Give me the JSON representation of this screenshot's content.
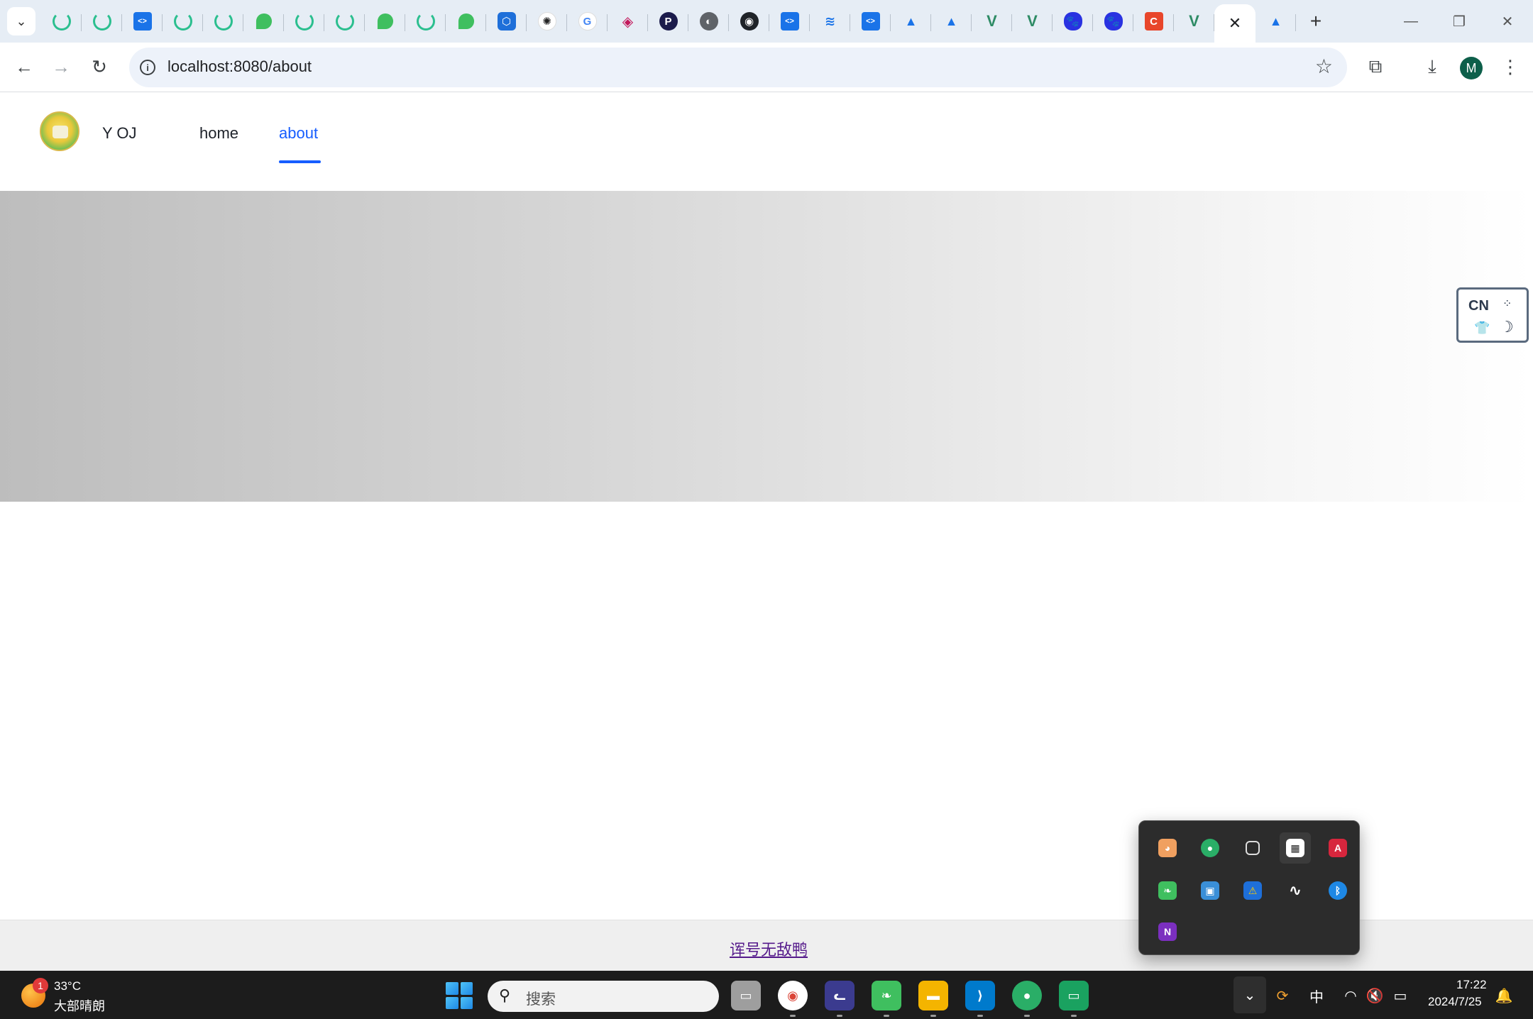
{
  "browser": {
    "tabs": [
      {
        "icon": "loading-spinner-icon"
      },
      {
        "icon": "loading-spinner-icon"
      },
      {
        "icon": "code-editor-icon"
      },
      {
        "icon": "loading-spinner-icon"
      },
      {
        "icon": "loading-spinner-icon"
      },
      {
        "icon": "leaf-icon"
      },
      {
        "icon": "loading-spinner-icon"
      },
      {
        "icon": "loading-spinner-icon"
      },
      {
        "icon": "leaf-icon"
      },
      {
        "icon": "loading-spinner-icon"
      },
      {
        "icon": "leaf-icon"
      },
      {
        "icon": "hexagon-icon"
      },
      {
        "icon": "openai-icon"
      },
      {
        "icon": "google-icon"
      },
      {
        "icon": "diamond-icon"
      },
      {
        "icon": "p-logo-icon"
      },
      {
        "icon": "globe-icon"
      },
      {
        "icon": "github-icon"
      },
      {
        "icon": "code-editor-icon"
      },
      {
        "icon": "layers-icon"
      },
      {
        "icon": "code-editor-icon"
      },
      {
        "icon": "arc-icon"
      },
      {
        "icon": "arc-icon"
      },
      {
        "icon": "vue-icon"
      },
      {
        "icon": "vue-icon"
      },
      {
        "icon": "baidu-icon"
      },
      {
        "icon": "baidu-icon"
      },
      {
        "icon": "c-logo-icon"
      },
      {
        "icon": "vue-icon"
      }
    ],
    "active_tab_close": "✕",
    "after_active_tab": {
      "icon": "arc-icon"
    },
    "new_tab": "+",
    "url": "localhost:8080/about",
    "profile_initial": "M"
  },
  "site": {
    "brand": "Y OJ",
    "menu": [
      {
        "label": "home",
        "active": false
      },
      {
        "label": "about",
        "active": true
      }
    ],
    "ime_widget": {
      "label": "CN"
    },
    "footer_link": "诨号无敌鸭"
  },
  "tray_popup": {
    "icons": [
      "cat-app-icon",
      "wechat-icon",
      "copy-icon",
      "app-grid-icon",
      "pdf-app-icon",
      "green-app-icon",
      "display-icon",
      "security-warning-icon",
      "n-logo-icon",
      "bluetooth-icon",
      "onenote-icon"
    ]
  },
  "taskbar": {
    "weather": {
      "temp": "33°C",
      "desc": "大部晴朗",
      "badge": "1"
    },
    "search_placeholder": "搜索",
    "ime_mode": "中",
    "clock": {
      "time": "17:22",
      "date": "2024/7/25"
    }
  },
  "colors": {
    "accent": "#165dff",
    "footer_bg": "#efefef",
    "taskbar_bg": "#1c1c1c"
  }
}
